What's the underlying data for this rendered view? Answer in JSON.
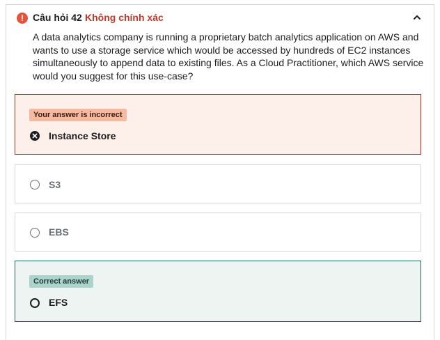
{
  "question": {
    "number_label": "Câu hỏi 42",
    "status_label": "Không chính xác",
    "text": "A data analytics company is running a proprietary batch analytics application on AWS and wants to use a storage service which would be accessed by hundreds of EC2 instances simultaneously to append data to existing files. As a Cloud Practitioner, which AWS service would you suggest for this use-case?"
  },
  "icons": {
    "status": "alert-circle-icon",
    "collapse": "chevron-up-icon"
  },
  "colors": {
    "incorrect_accent": "#c0392b",
    "incorrect_bg": "#fdefea",
    "correct_bg": "#eef4f1",
    "correct_border": "#1e6055"
  },
  "options": [
    {
      "label": "Instance Store",
      "state": "selected-incorrect",
      "tag": "Your answer is incorrect"
    },
    {
      "label": "S3",
      "state": "unselected"
    },
    {
      "label": "EBS",
      "state": "unselected"
    },
    {
      "label": "EFS",
      "state": "correct",
      "tag": "Correct answer"
    }
  ]
}
